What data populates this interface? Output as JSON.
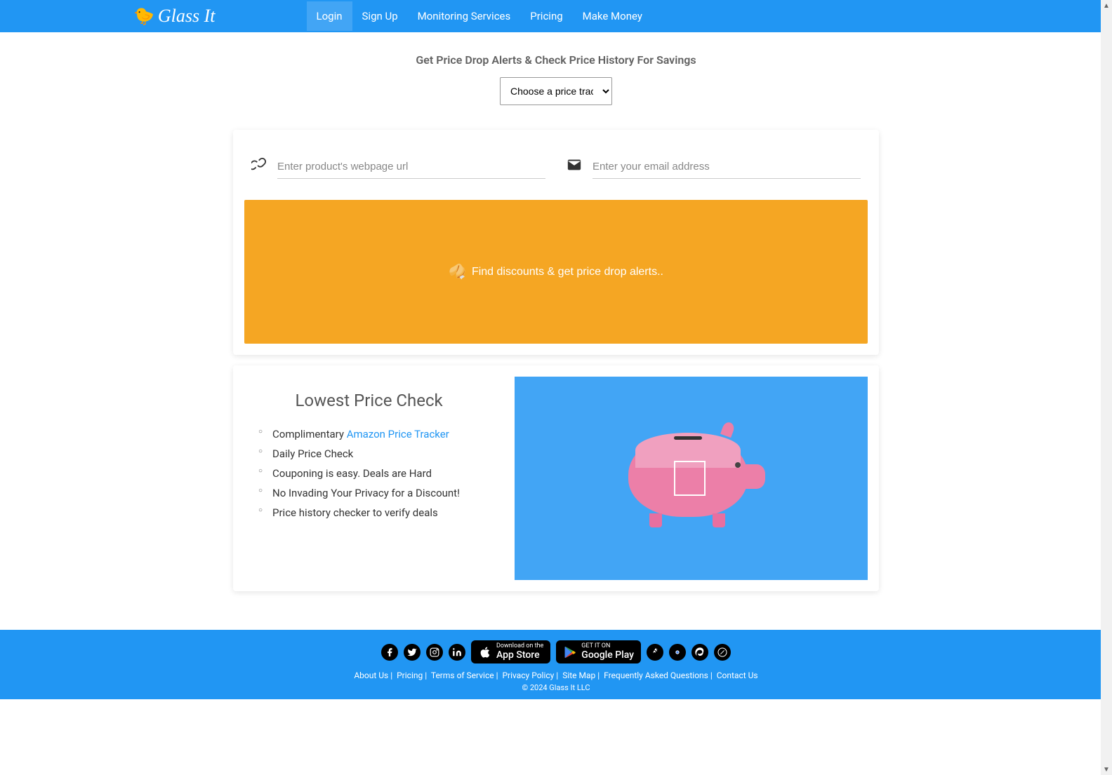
{
  "brand": "Glass It",
  "nav": {
    "login": "Login",
    "signup": "Sign Up",
    "monitoring": "Monitoring Services",
    "pricing": "Pricing",
    "make_money": "Make Money"
  },
  "hero": {
    "title": "Get Price Drop Alerts & Check Price History For Savings",
    "select_placeholder": "Choose a price tracker"
  },
  "form": {
    "url_placeholder": "Enter product's webpage url",
    "email_placeholder": "Enter your email address",
    "cta_label": "Find discounts & get price drop alerts.."
  },
  "feature": {
    "title": "Lowest Price Check",
    "items": [
      {
        "prefix": "Complimentary ",
        "link": "Amazon Price Tracker",
        "suffix": ""
      },
      {
        "prefix": "Daily Price Check",
        "link": "",
        "suffix": ""
      },
      {
        "prefix": "Couponing is easy. Deals are Hard",
        "link": "",
        "suffix": ""
      },
      {
        "prefix": "No Invading Your Privacy for a Discount!",
        "link": "",
        "suffix": ""
      },
      {
        "prefix": "Price history checker to verify deals",
        "link": "",
        "suffix": ""
      }
    ]
  },
  "footer": {
    "appstore_small": "Download on the",
    "appstore_big": "App Store",
    "playstore_small": "GET IT ON",
    "playstore_big": "Google Play",
    "links": {
      "about": "About Us",
      "pricing": "Pricing",
      "terms": "Terms of Service",
      "privacy": "Privacy Policy",
      "sitemap": "Site Map",
      "faq": "Frequently Asked Questions",
      "contact": "Contact Us"
    },
    "copyright": "© 2024 Glass It LLC"
  }
}
